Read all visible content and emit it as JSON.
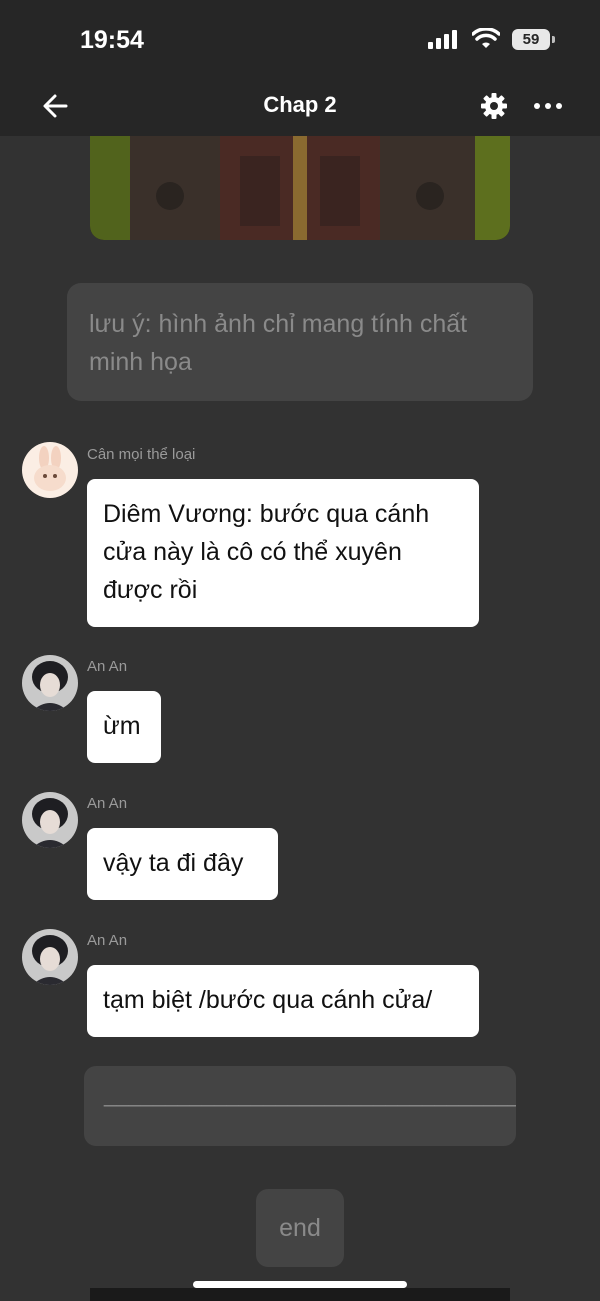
{
  "status_bar": {
    "time": "19:54",
    "battery": "59"
  },
  "nav": {
    "title": "Chap 2"
  },
  "note": {
    "text": "lưu ý: hình ảnh chỉ mang tính chất minh họa"
  },
  "messages": [
    {
      "sender": "Cân mọi thể loại",
      "text": "Diêm Vương: bước qua cánh cửa này là cô có thể xuyên được rồi"
    },
    {
      "sender": "An An",
      "text": "ừm"
    },
    {
      "sender": "An An",
      "text": "vậy ta đi đây"
    },
    {
      "sender": "An An",
      "text": "tạm biệt /bước qua cánh cửa/"
    }
  ],
  "divider": {
    "text": "_______________________________________"
  },
  "end": {
    "label": "end"
  },
  "colors": {
    "background": "#323232",
    "bubble": "#ffffff",
    "panel": "#444444",
    "topbar": "#262626"
  },
  "icons": {
    "back": "arrow-left-icon",
    "settings": "gear-icon",
    "more": "more-horizontal-icon",
    "signal": "signal-icon",
    "wifi": "wifi-icon",
    "battery": "battery-icon"
  }
}
